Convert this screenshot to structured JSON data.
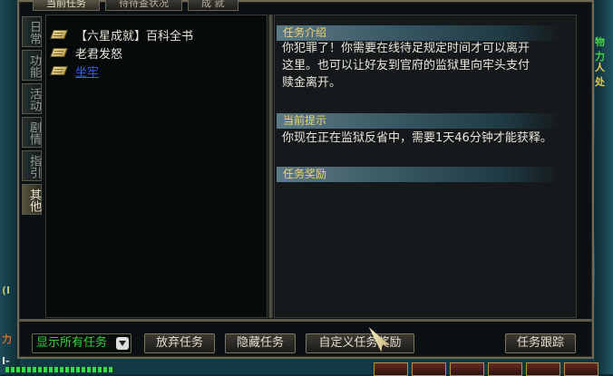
{
  "top_tabs": [
    {
      "label": "当前任务",
      "active": true
    },
    {
      "label": "待待查状况",
      "active": false
    },
    {
      "label": "成 就",
      "active": false
    }
  ],
  "side_tabs": [
    {
      "label": "日常"
    },
    {
      "label": "功能"
    },
    {
      "label": "活动"
    },
    {
      "label": "剧情"
    },
    {
      "label": "指引"
    },
    {
      "label": "其他",
      "active": true
    }
  ],
  "quest_list": [
    {
      "label": "【六星成就】百科全书",
      "icon": "book-icon"
    },
    {
      "label": "老君发怒",
      "icon": "book-icon"
    },
    {
      "label": "坐牢",
      "icon": "book-icon",
      "selected": true
    }
  ],
  "detail": {
    "intro_title": "任务介绍",
    "intro_line1": "你犯罪了！你需要在线待足规定时间才可以离开",
    "intro_line2": "这里。也可以让好友到官府的监狱里向牢头支付",
    "intro_line3": "赎金离开。",
    "hint_title": "当前提示",
    "hint_text": "你现在正在监狱反省中，需要1天46分钟才能获释。",
    "reward_title": "任务奖励"
  },
  "buttons": {
    "show_all": "显示所有任务",
    "abandon": "放弃任务",
    "hide": "隐藏任务",
    "custom": "自定义任务奖励",
    "track": "任务跟踪"
  },
  "edge": {
    "left_text": "(I",
    "left_text2": "力",
    "left_text3": "I-",
    "right_text": "物力",
    "right_text2": "人处"
  }
}
